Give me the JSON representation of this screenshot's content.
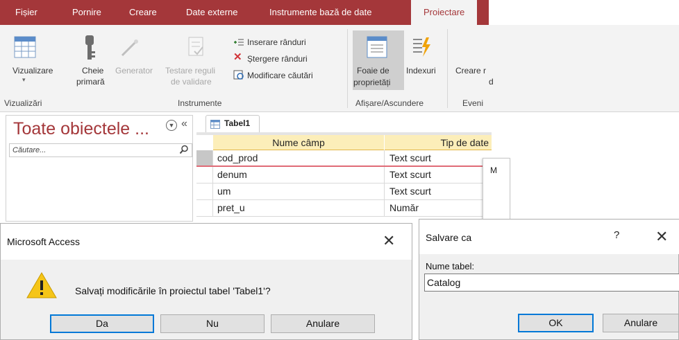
{
  "ribbon": {
    "tabs": [
      "Fișier",
      "Pornire",
      "Creare",
      "Date externe",
      "Instrumente bază de date",
      "Proiectare"
    ],
    "active_tab": "Proiectare",
    "buttons": {
      "view": "Vizualizare",
      "primary_key_1": "Cheie",
      "primary_key_2": "primară",
      "builder": "Generator",
      "test_rules_1": "Testare reguli",
      "test_rules_2": "de validare",
      "insert_rows": "Inserare rânduri",
      "delete_rows": "Ștergere rânduri",
      "modify_lookups": "Modificare căutări",
      "property_sheet_1": "Foaie de",
      "property_sheet_2": "proprietăți",
      "indexes": "Indexuri",
      "create_macros_1": "Creare r",
      "create_macros_2": "d"
    },
    "groups": {
      "views": "Vizualizări",
      "tools": "Instrumente",
      "show_hide": "Afișare/Ascundere",
      "events": "Eveni"
    }
  },
  "nav": {
    "title": "Toate obiectele ...",
    "search_placeholder": "Căutare..."
  },
  "document": {
    "tab_label": "Tabel1",
    "columns": [
      "Nume câmp",
      "Tip de date"
    ],
    "rows": [
      {
        "field": "cod_prod",
        "type": "Text scurt"
      },
      {
        "field": "denum",
        "type": "Text scurt"
      },
      {
        "field": "um",
        "type": "Text scurt"
      },
      {
        "field": "pret_u",
        "type": "Număr"
      }
    ],
    "popup_letter": "M"
  },
  "dialog_save_changes": {
    "title": "Microsoft Access",
    "message": "Salvați modificările în proiectul tabel 'Tabel1'?",
    "buttons": {
      "yes": "Da",
      "no": "Nu",
      "cancel": "Anulare"
    }
  },
  "dialog_save_as": {
    "title": "Salvare ca",
    "help": "?",
    "field_label": "Nume tabel:",
    "field_value": "Catalog",
    "buttons": {
      "ok": "OK",
      "cancel": "Anulare"
    }
  },
  "colors": {
    "accent": "#a4373a",
    "header_bg": "#fceeb9",
    "warning": "#f5c518",
    "focus": "#0078d7"
  }
}
